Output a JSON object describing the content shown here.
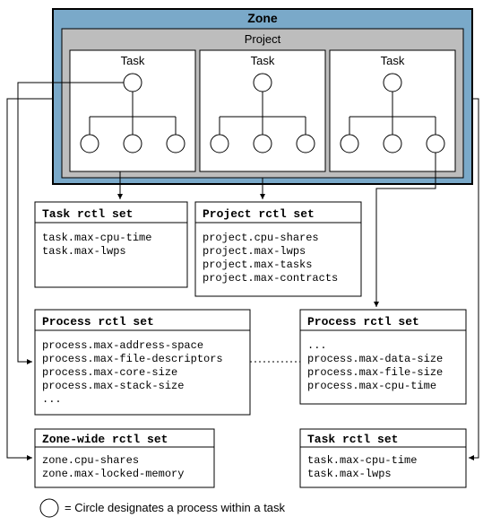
{
  "zone": {
    "title": "Zone",
    "project": {
      "title": "Project",
      "tasks": [
        {
          "label": "Task"
        },
        {
          "label": "Task"
        },
        {
          "label": "Task"
        }
      ]
    }
  },
  "boxes": {
    "task_rctl_left": {
      "title": "Task rctl set",
      "lines": [
        "task.max-cpu-time",
        "task.max-lwps"
      ]
    },
    "project_rctl": {
      "title": "Project rctl set",
      "lines": [
        "project.cpu-shares",
        "project.max-lwps",
        "project.max-tasks",
        "project.max-contracts"
      ]
    },
    "process_rctl_left": {
      "title": "Process rctl set",
      "lines": [
        "process.max-address-space",
        "process.max-file-descriptors",
        "process.max-core-size",
        "process.max-stack-size",
        "..."
      ]
    },
    "process_rctl_right": {
      "title": "Process rctl set",
      "lines": [
        "...",
        "process.max-data-size",
        "process.max-file-size",
        "process.max-cpu-time"
      ]
    },
    "zone_wide": {
      "title": "Zone-wide rctl set",
      "lines": [
        "zone.cpu-shares",
        "zone.max-locked-memory"
      ]
    },
    "task_rctl_right": {
      "title": "Task rctl set",
      "lines": [
        "task.max-cpu-time",
        "task.max-lwps"
      ]
    }
  },
  "legend": "= Circle designates a process within a task",
  "colors": {
    "zone_border": "#000",
    "zone_fill": "#7aa9c9",
    "zone_title_fill": "#7aa9c9",
    "project_fill": "#bdbdbd",
    "task_fill": "#ffffff"
  }
}
